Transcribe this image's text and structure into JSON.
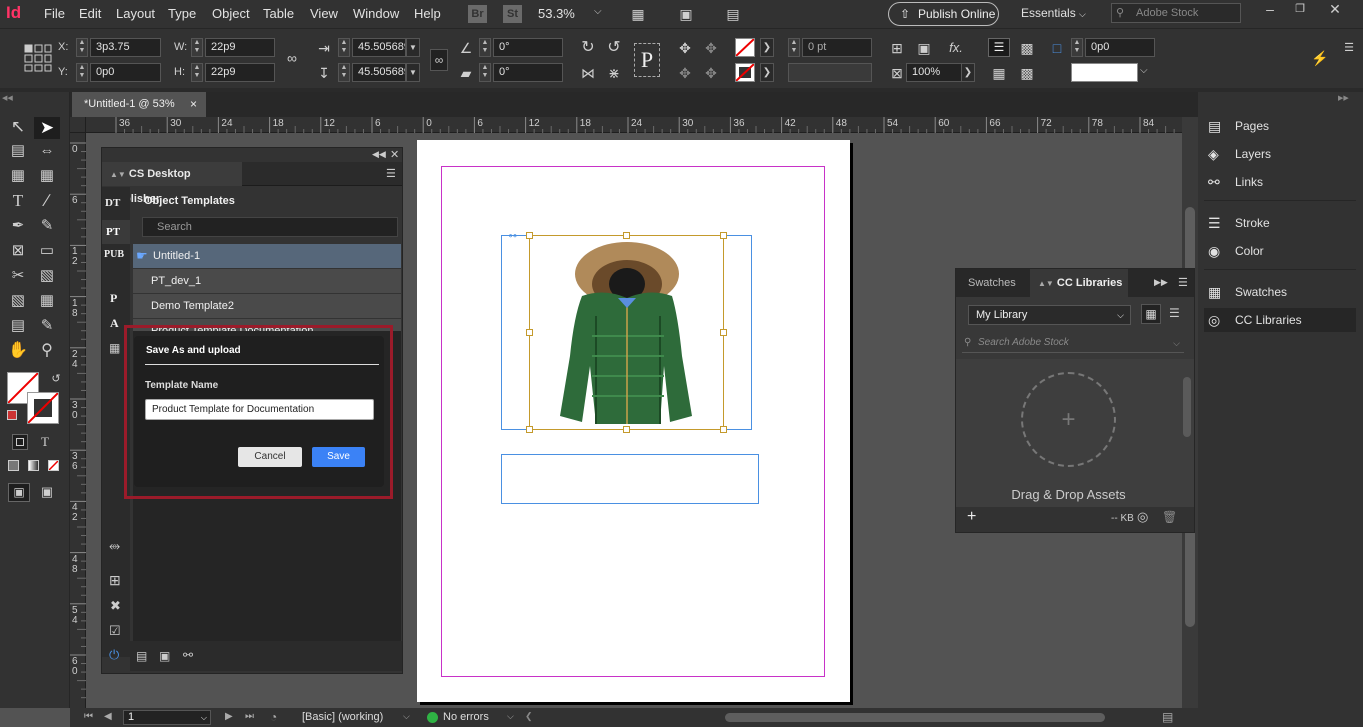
{
  "app": {
    "logo": "Id",
    "menus": [
      "File",
      "Edit",
      "Layout",
      "Type",
      "Object",
      "Table",
      "View",
      "Window",
      "Help"
    ],
    "bridge": "Br",
    "stock": "St",
    "zoom": "53.3%",
    "publish": "Publish Online",
    "workspace": "Essentials",
    "search_placeholder": "Adobe Stock"
  },
  "control": {
    "x_label": "X:",
    "x_value": "3p3.75",
    "y_label": "Y:",
    "y_value": "0p0",
    "w_label": "W:",
    "w_value": "22p9",
    "h_label": "H:",
    "h_value": "22p9",
    "scale_x": "45.5056891",
    "scale_y": "45.5056891",
    "angle": "0°",
    "shear": "0°",
    "stroke_weight": "0 pt",
    "opacity": "100%",
    "offset": "0p0"
  },
  "tab": {
    "title": "*Untitled-1 @ 53%",
    "close": "×"
  },
  "ruler": {
    "h": [
      "36",
      "30",
      "24",
      "18",
      "12",
      "6",
      "0",
      "6",
      "12",
      "18",
      "24",
      "30",
      "36",
      "42",
      "48",
      "54",
      "60",
      "66",
      "72",
      "78",
      "84"
    ],
    "v": [
      "0",
      "6",
      "1 2",
      "1 8",
      "2 4",
      "3 0",
      "3 6",
      "4 2",
      "4 8",
      "5 4",
      "6 0"
    ]
  },
  "plugin": {
    "title": "CS Desktop Publisher",
    "section": "Object Templates",
    "search_placeholder": "Search",
    "side_tabs": [
      "DT",
      "PT",
      "PUB"
    ],
    "rows": [
      "Untitled-1",
      "PT_dev_1",
      "Demo Template2",
      "Product Template Documentation"
    ],
    "side_letters": [
      "P",
      "A"
    ]
  },
  "dialog": {
    "title": "Save As and upload",
    "label": "Template Name",
    "value": "Product Template for Documentation",
    "cancel": "Cancel",
    "save": "Save"
  },
  "dock": {
    "items": [
      "Pages",
      "Layers",
      "Links",
      "Stroke",
      "Color",
      "Swatches",
      "CC Libraries"
    ]
  },
  "library": {
    "tabs": [
      "Swatches",
      "CC Libraries"
    ],
    "library_select": "My Library",
    "search_placeholder": "Search Adobe Stock",
    "drop_text": "Drag & Drop Assets",
    "size": "-- KB"
  },
  "status": {
    "page": "1",
    "style": "[Basic] (working)",
    "errors": "No errors"
  },
  "colors": {
    "accent": "#ff3366",
    "save_blue": "#3b82f6",
    "highlight": "#9b1b2a",
    "margin": "#c832c8",
    "frame": "#4a90e2",
    "selection": "#c49a2c"
  }
}
